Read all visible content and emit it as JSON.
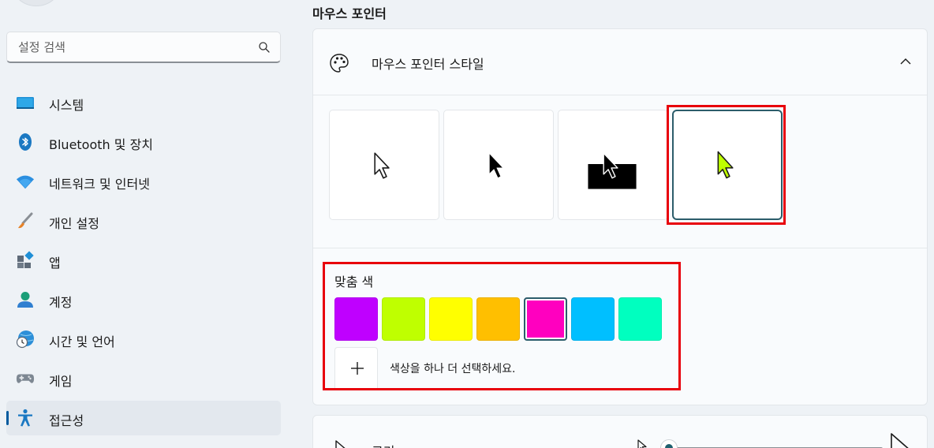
{
  "sidebar": {
    "search_placeholder": "설정 검색",
    "items": [
      {
        "label": "시스템",
        "icon": "system-monitor-icon"
      },
      {
        "label": "Bluetooth 및 장치",
        "icon": "bluetooth-icon"
      },
      {
        "label": "네트워크 및 인터넷",
        "icon": "wifi-icon"
      },
      {
        "label": "개인 설정",
        "icon": "paintbrush-icon"
      },
      {
        "label": "앱",
        "icon": "apps-icon"
      },
      {
        "label": "계정",
        "icon": "account-icon"
      },
      {
        "label": "시간 및 언어",
        "icon": "globe-clock-icon"
      },
      {
        "label": "게임",
        "icon": "gamepad-icon"
      },
      {
        "label": "접근성",
        "icon": "accessibility-icon",
        "active": true
      }
    ]
  },
  "main": {
    "section_title": "마우스 포인터",
    "pointer_style": {
      "title": "마우스 포인터 스타일",
      "icon": "palette-icon",
      "expanded": true,
      "styles": [
        "white",
        "black",
        "inverted",
        "custom"
      ],
      "selected_style": "custom"
    },
    "custom_color": {
      "label": "맞춤 색",
      "swatches": [
        "#bf00ff",
        "#bfff00",
        "#ffff00",
        "#ffbf00",
        "#ff00bf",
        "#00bfff",
        "#00ffbf"
      ],
      "selected_index": 4,
      "add_text": "색상을 하나 더 선택하세요."
    },
    "size": {
      "label": "크기"
    }
  },
  "colors": {
    "accent": "#005a9e",
    "selected_border": "#2c5d6b",
    "highlight": "#e8000b",
    "custom_pointer": "#bfff00"
  }
}
